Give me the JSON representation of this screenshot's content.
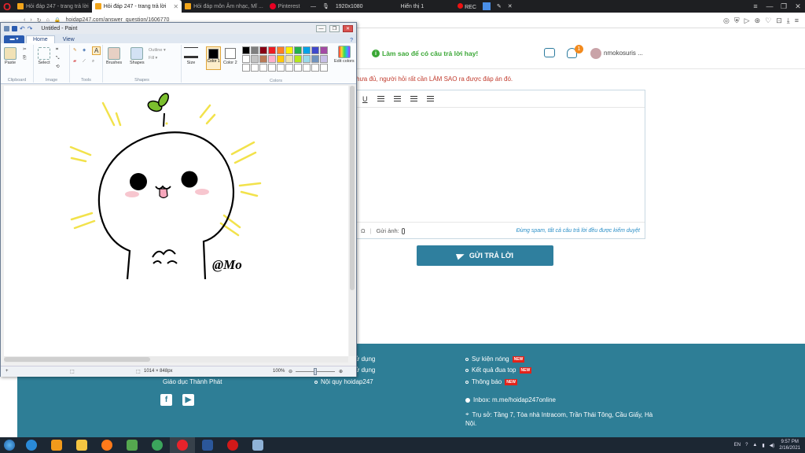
{
  "browser": {
    "tabs": [
      {
        "label": "Hỏi đáp 247 - trang trả lời",
        "fav_color": "#f2a51a",
        "active": false
      },
      {
        "label": "Hỏi đáp 247 - trang trả lời",
        "fav_color": "#f2a51a",
        "active": true
      },
      {
        "label": "Hỏi đáp môn Âm nhạc, Mĩ ...",
        "fav_color": "#f2a51a",
        "active": false
      },
      {
        "label": "Pinterest",
        "fav_color": "#e60023",
        "active": false
      }
    ],
    "resolution": "1920x1080",
    "display_label": "Hiển thị 1",
    "rec_label": "REC",
    "url": "hoidap247.com/answer_question/1606770"
  },
  "header": {
    "tip": "Làm sao để có câu trả lời hay!",
    "notification_count": "1",
    "username": "nmokosuris ..."
  },
  "answer": {
    "hint": "hưa đủ, người hỏi rất cần LÀM SAO ra được đáp án đó.",
    "toolbar_underline": "U",
    "attach_label": "Gửi ảnh:",
    "spam_note": "Đừng spam, tất cả câu trả lời đều được kiểm duyệt",
    "submit_label": "GỬI TRẢ LỜI"
  },
  "footer": {
    "col1": [
      "ử dụng",
      "ử dụng"
    ],
    "company": "Giáo dục Thành Phát",
    "rules": "Nội quy hoidap247",
    "col3": [
      {
        "label": "Sự kiện nóng",
        "new": "NEW"
      },
      {
        "label": "Kết quả đua top",
        "new": "NEW"
      },
      {
        "label": "Thông báo",
        "new": "NEW"
      }
    ],
    "inbox": "Inbox: m.me/hoidap247online",
    "address_line1": "Trụ sở: Tầng 7, Tòa nhà Intracom, Trần Thái Tông, Cầu Giấy, Hà",
    "address_line2": "Nội.",
    "social": [
      "f",
      "▶"
    ]
  },
  "paint": {
    "title": "Untitled - Paint",
    "file_tab": "▬ ▾",
    "tabs": [
      "Home",
      "View"
    ],
    "groups": [
      "Clipboard",
      "Image",
      "Tools",
      "Shapes",
      "Colors"
    ],
    "tools": {
      "paste": "Paste",
      "select": "Select",
      "brushes": "Brushes",
      "shapes": "Shapes",
      "outline": "Outline ▾",
      "fill": "Fill ▾",
      "size": "Size",
      "color1": "Color 1",
      "color2": "Color 2",
      "edit_colors": "Edit colors"
    },
    "palette": [
      "#000000",
      "#7f7f7f",
      "#880015",
      "#ed1c24",
      "#ff7f27",
      "#fff200",
      "#22b14c",
      "#00a2e8",
      "#3f48cc",
      "#a349a4",
      "#ffffff",
      "#c3c3c3",
      "#b97a57",
      "#ffaec9",
      "#ffc90e",
      "#efe4b0",
      "#b5e61d",
      "#99d9ea",
      "#7092be",
      "#c8bfe7",
      "#ffffff",
      "#ffffff",
      "#ffffff",
      "#ffffff",
      "#ffffff",
      "#ffffff",
      "#ffffff",
      "#ffffff",
      "#ffffff",
      "#ffffff"
    ],
    "drawing_signature": "@Mo",
    "status_size": "1014 × 848px",
    "zoom": "100%"
  },
  "taskbar": {
    "apps": [
      {
        "name": "internet-explorer",
        "color": "#2a8ad8"
      },
      {
        "name": "media-player",
        "color": "#f29a1b"
      },
      {
        "name": "file-explorer",
        "color": "#f4c542"
      },
      {
        "name": "firefox",
        "color": "#ff7a1a"
      },
      {
        "name": "utility",
        "color": "#55a84f"
      },
      {
        "name": "chrome",
        "color": "#3ba55c"
      },
      {
        "name": "opera",
        "color": "#e8232b"
      },
      {
        "name": "word",
        "color": "#2b579a"
      },
      {
        "name": "recorder",
        "color": "#d01919"
      },
      {
        "name": "paint",
        "color": "#8fb2d6"
      }
    ],
    "lang": "EN",
    "time": "9:57 PM",
    "date": "2/16/2021"
  }
}
